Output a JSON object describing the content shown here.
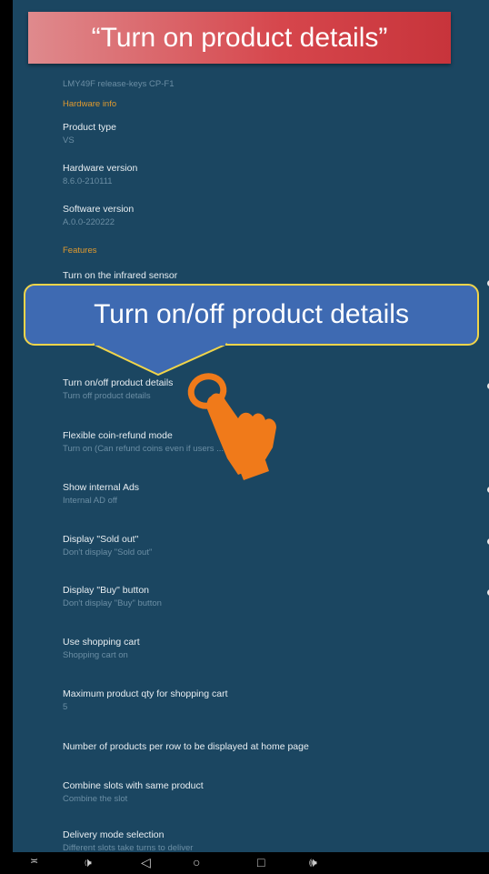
{
  "banner": {
    "text": "“Turn on product details”"
  },
  "callout": {
    "text": "Turn on/off product details"
  },
  "build": {
    "value": "LMY49F release-keys CP-F1"
  },
  "hardware_section": {
    "title": "Hardware info"
  },
  "product_type": {
    "title": "Product type",
    "value": "VS"
  },
  "hardware_version": {
    "title": "Hardware version",
    "value": "8.6.0-210111"
  },
  "software_version": {
    "title": "Software version",
    "value": "A.0.0-220222"
  },
  "features_section": {
    "title": "Features"
  },
  "settings": [
    {
      "title": "Turn on the infrared sensor",
      "subtitle": ""
    },
    {
      "title": "Turn on/off product details",
      "subtitle": "Turn off product details"
    },
    {
      "title": "Flexible coin-refund mode",
      "subtitle": "Turn on (Can refund coins even if users ... machine)"
    },
    {
      "title": "Show internal Ads",
      "subtitle": "Internal AD off"
    },
    {
      "title": "Display \"Sold out\"",
      "subtitle": "Don't display \"Sold out\""
    },
    {
      "title": "Display \"Buy\" button",
      "subtitle": "Don't display \"Buy\" button"
    },
    {
      "title": "Use shopping cart",
      "subtitle": "Shopping cart on"
    },
    {
      "title": "Maximum product qty for shopping cart",
      "subtitle": "5"
    },
    {
      "title": "Number of products per row to be displayed at home page",
      "subtitle": ""
    },
    {
      "title": "Combine slots with same product",
      "subtitle": "Combine the slot"
    },
    {
      "title": "Delivery mode selection",
      "subtitle": "Different slots take turns to deliver"
    }
  ],
  "toggles": {
    "infrared": "off",
    "product_details": "off",
    "coin_refund": "on",
    "internal_ads": "off",
    "sold_out": "off",
    "buy_button": "off",
    "shopping_cart": "on",
    "combine_slots": "on"
  },
  "navbar": {
    "icons": [
      "menu-icon",
      "volume-down-icon",
      "back-icon",
      "home-icon",
      "recents-icon",
      "volume-up-icon"
    ]
  }
}
